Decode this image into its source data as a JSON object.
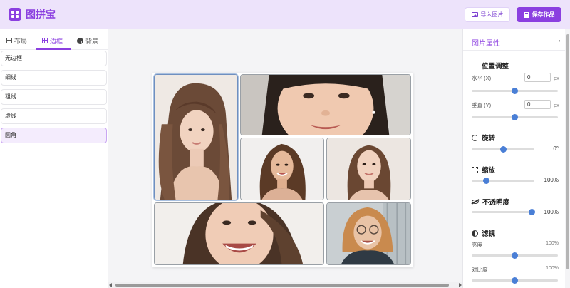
{
  "header": {
    "title": "图拼宝",
    "import_label": "导入图片",
    "save_label": "保存作品"
  },
  "left_panel": {
    "tabs": [
      {
        "label": "布局",
        "icon": "grid-icon",
        "active": false
      },
      {
        "label": "边框",
        "icon": "border-icon",
        "active": true
      },
      {
        "label": "背景",
        "icon": "palette-icon",
        "active": false
      }
    ],
    "border_options": [
      {
        "label": "无边框",
        "selected": false
      },
      {
        "label": "细线",
        "selected": false
      },
      {
        "label": "粗线",
        "selected": false
      },
      {
        "label": "虚线",
        "selected": false
      },
      {
        "label": "圆角",
        "selected": true
      }
    ]
  },
  "canvas": {
    "photos": [
      {
        "name": "photo-woman-long-hair",
        "selected": true
      },
      {
        "name": "photo-smiling-closeup",
        "selected": false
      },
      {
        "name": "photo-woman-brown-hair",
        "selected": false
      },
      {
        "name": "photo-woman-portrait",
        "selected": false
      },
      {
        "name": "photo-laughing-woman",
        "selected": false
      },
      {
        "name": "photo-woman-glasses",
        "selected": false
      }
    ]
  },
  "right_panel": {
    "title": "图片属性",
    "position": {
      "title": "位置调整",
      "horizontal_label": "水平 (X)",
      "horizontal_value": "0",
      "vertical_label": "垂直 (Y)",
      "vertical_value": "0",
      "unit": "px"
    },
    "rotation": {
      "title": "旋转",
      "value": "0°",
      "level": 0.5
    },
    "scale": {
      "title": "缩放",
      "value": "100%",
      "level": 0.2
    },
    "opacity": {
      "title": "不透明度",
      "value": "100%",
      "level": 1.0
    },
    "filter": {
      "title": "滤镜",
      "brightness_label": "亮度",
      "brightness_value": "100%",
      "contrast_label": "对比度",
      "contrast_value": "100%"
    }
  },
  "colors": {
    "accent": "#8b3fe0",
    "header_bg": "#ede3fb",
    "slider_knob": "#4a7fd6"
  }
}
